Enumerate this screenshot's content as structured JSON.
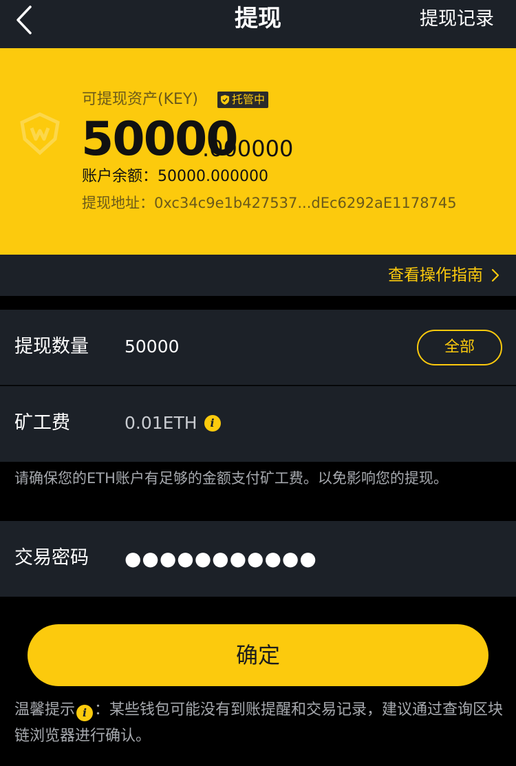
{
  "nav": {
    "title": "提现",
    "right_link": "提现记录"
  },
  "asset": {
    "label": "可提现资产(KEY)",
    "badge": "托管中",
    "amount_int": "50000",
    "amount_dec": ".000000",
    "balance_label": "账户余额：",
    "balance_value": "50000.000000",
    "address_label": "提现地址：",
    "address_value": "0xc34c9e1b427537...dEc6292aE1178745"
  },
  "guide": {
    "label": "查看操作指南",
    "chevron": "›"
  },
  "form": {
    "amount_label": "提现数量",
    "amount_value": "50000",
    "all_button": "全部",
    "fee_label": "矿工费",
    "fee_value": "0.01ETH",
    "fee_note": "请确保您的ETH账户有足够的金额支付矿工费。以免影响您的提现。",
    "password_label": "交易密码",
    "password_mask": "●●●●●●●●●●●"
  },
  "confirm_label": "确定",
  "tip": {
    "prefix": "温馨提示",
    "text": "：某些钱包可能没有到账提醒和交易记录，建议通过查询区块链浏览器进行确认。"
  },
  "colors": {
    "accent": "#fcca0d",
    "panel": "#1c2128",
    "background": "#000000"
  },
  "icons": {
    "back": "chevron-left-icon",
    "guide": "chevron-right-icon",
    "info": "info-icon",
    "shield": "shield-check-icon"
  }
}
